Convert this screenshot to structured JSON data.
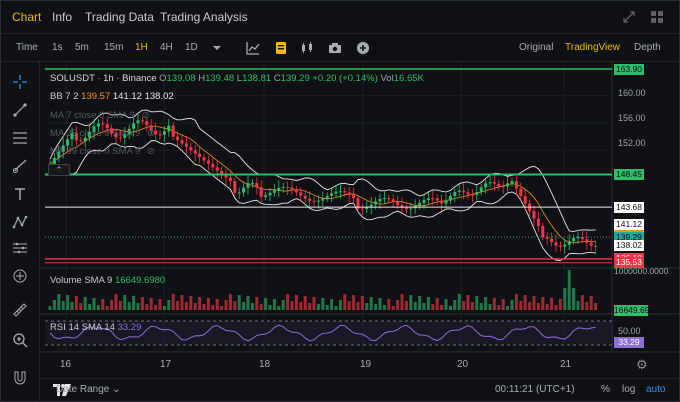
{
  "tabs": [
    {
      "label": "Chart"
    },
    {
      "label": "Info"
    },
    {
      "label": "Trading Data"
    },
    {
      "label": "Trading Analysis"
    }
  ],
  "toolbar": {
    "timeframes": [
      "Time",
      "1s",
      "5m",
      "15m",
      "1H",
      "4H",
      "1D"
    ],
    "active_timeframe": "1H",
    "views": [
      "Original",
      "TradingView",
      "Depth"
    ],
    "active_view": "TradingView"
  },
  "legend": {
    "symbol_line": "SOLUSDT · 1h · Binance",
    "o_label": "O",
    "o_value": "139.08",
    "h_label": "H",
    "h_value": "139.48",
    "l_label": "L",
    "l_value": "138.81",
    "c_label": "C",
    "c_value": "139.29",
    "change": "+0.20 (+0.14%)",
    "vol_label": "Vol",
    "vol_value": "16.65K",
    "bb_label": "BB 7 2",
    "bb_upper": "139.57",
    "bb_mid": "141.12",
    "bb_lower": "138.02",
    "ma1": "MA 7 close 0 SMA 9",
    "ma2": "MA 25 close 0 SMA 9",
    "ma3": "MA 99 close 0 SMA 9",
    "volume_label": "Volume SMA 9",
    "volume_value": "16649.6980",
    "rsi_label": "RSI 14 SMA 14",
    "rsi_value": "33.29"
  },
  "price_axis": [
    "160.00",
    "156.00",
    "152.00"
  ],
  "price_tags": [
    {
      "value": "163.90",
      "color": "#2ebd6b",
      "text_color": "#0c0e12"
    },
    {
      "value": "148.45",
      "color": "#2ebd6b",
      "text_color": "#0c0e12"
    },
    {
      "value": "143.68",
      "color": "#ffffff",
      "text_color": "#0c0e12"
    },
    {
      "value": "141.12",
      "color": "#ffffff",
      "text_color": "#0c0e12"
    },
    {
      "value": "139.57",
      "color": "#f7931a",
      "text_color": "#0c0e12"
    },
    {
      "value": "139.29",
      "color": "#26a69a",
      "text_color": "#0c0e12"
    },
    {
      "value": "138.02",
      "color": "#ffffff",
      "text_color": "#0c0e12"
    },
    {
      "value": "136.10",
      "color": "#f23645",
      "text_color": "#ffffff"
    },
    {
      "value": "135.53",
      "color": "#f23645",
      "text_color": "#ffffff"
    }
  ],
  "volume_axis": "1000000.0000",
  "volume_tag": "16649.6980",
  "rsi_axis": "50.00",
  "rsi_tag": "33.29",
  "time_axis": [
    "16",
    "17",
    "18",
    "19",
    "20",
    "21"
  ],
  "bottom": {
    "date_range": "Date Range",
    "clock": "00:11:21 (UTC+1)",
    "percent": "%",
    "log": "log",
    "auto": "auto"
  },
  "colors": {
    "accent": "#f0b90b",
    "up": "#2ebd6b",
    "down": "#f23645",
    "rsi": "#8e6fd8"
  }
}
